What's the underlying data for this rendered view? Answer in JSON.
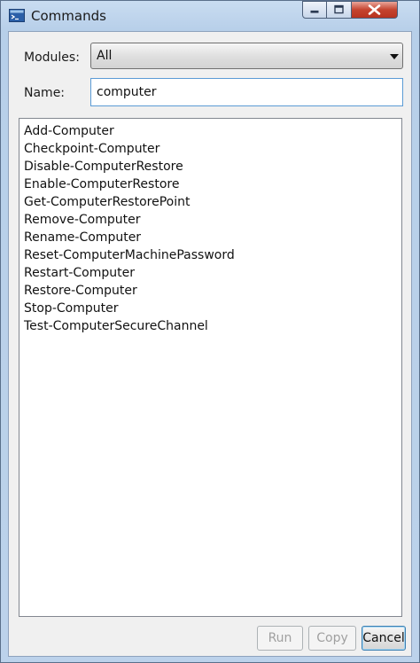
{
  "window": {
    "title": "Commands",
    "icon": "powershell-window-icon",
    "caption_buttons": [
      "minimize-icon",
      "maximize-icon",
      "close-icon"
    ]
  },
  "filters": {
    "modules_label": "Modules:",
    "modules_value": "All",
    "name_label": "Name:",
    "name_value": "computer"
  },
  "commands": [
    "Add-Computer",
    "Checkpoint-Computer",
    "Disable-ComputerRestore",
    "Enable-ComputerRestore",
    "Get-ComputerRestorePoint",
    "Remove-Computer",
    "Rename-Computer",
    "Reset-ComputerMachinePassword",
    "Restart-Computer",
    "Restore-Computer",
    "Stop-Computer",
    "Test-ComputerSecureChannel"
  ],
  "buttons": {
    "run": "Run",
    "copy": "Copy",
    "cancel": "Cancel"
  },
  "colors": {
    "close_button": "#c5442f",
    "input_focus_border": "#5b9bd5"
  }
}
